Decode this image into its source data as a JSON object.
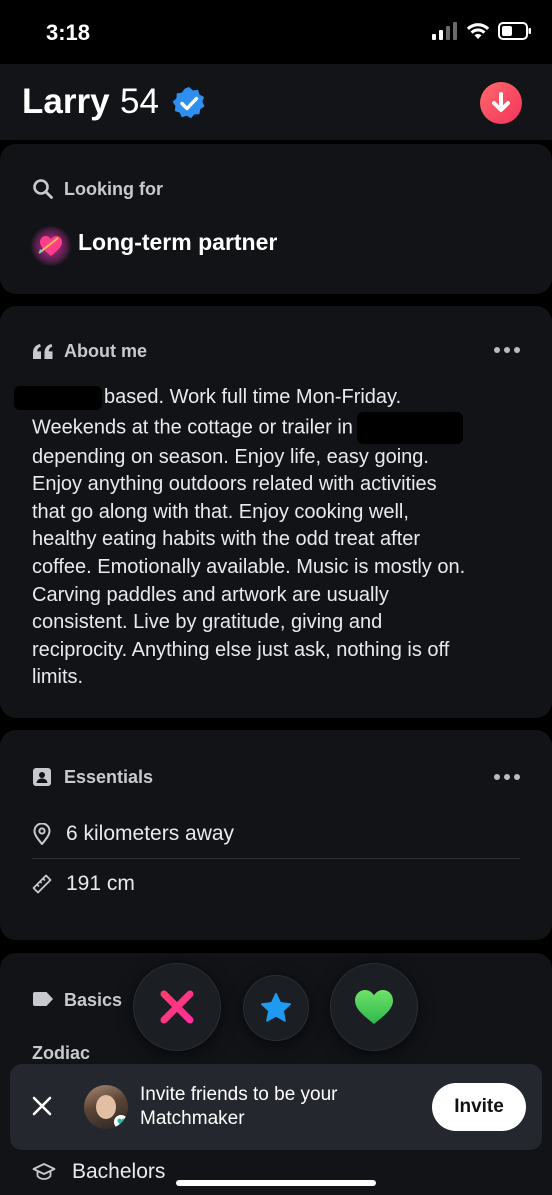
{
  "status_bar": {
    "time": "3:18"
  },
  "header": {
    "name": "Larry",
    "age": "54"
  },
  "looking_for": {
    "title": "Looking for",
    "value": "Long-term partner"
  },
  "about": {
    "title": "About me",
    "lines": [
      "based. Work full time Mon-Friday.",
      "Weekends at the cottage or trailer in",
      "depending on season. Enjoy life, easy going.",
      "Enjoy anything outdoors related with activities",
      "that go along with that. Enjoy cooking well,",
      "healthy eating habits with the odd treat after",
      "coffee. Emotionally available. Music is mostly on.",
      "Carving paddles and artwork are usually",
      "consistent. Live by gratitude, giving and",
      "reciprocity. Anything else just ask, nothing is off",
      "limits."
    ]
  },
  "essentials": {
    "title": "Essentials",
    "distance": "6 kilometers away",
    "height": "191 cm"
  },
  "basics": {
    "title": "Basics",
    "zodiac_label": "Zodiac"
  },
  "toast": {
    "text": "Invite friends to be your Matchmaker",
    "button": "Invite"
  },
  "education": {
    "value": "Bachelors"
  },
  "colors": {
    "accent_pink": "#f2335c",
    "verified_blue": "#2f8ff0",
    "like_green": "#4fd35a",
    "superlike_blue": "#1e9bf0",
    "nope_pink": "#ff2e7e"
  }
}
